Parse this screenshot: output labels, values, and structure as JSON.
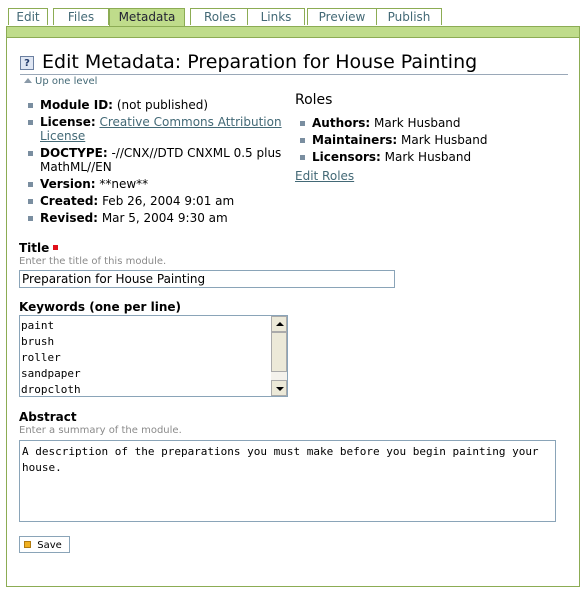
{
  "tabs": [
    {
      "label": "Edit",
      "selected": false
    },
    {
      "label": "Files",
      "selected": false
    },
    {
      "label": "Metadata",
      "selected": true
    },
    {
      "label": "Roles",
      "selected": false
    },
    {
      "label": "Links",
      "selected": false
    },
    {
      "label": "Preview",
      "selected": false
    },
    {
      "label": "Publish",
      "selected": false
    }
  ],
  "header": {
    "help_icon": "?",
    "title": "Edit Metadata: Preparation for House Painting",
    "up_link": "Up one level"
  },
  "meta": {
    "module_id_label": "Module ID:",
    "module_id_value": "(not published)",
    "license_label": "License:",
    "license_link": "Creative Commons Attribution License",
    "doctype_label": "DOCTYPE:",
    "doctype_value": "-//CNX//DTD CNXML 0.5 plus MathML//EN",
    "version_label": "Version:",
    "version_value": "**new**",
    "created_label": "Created:",
    "created_value": "Feb 26, 2004 9:01 am",
    "revised_label": "Revised:",
    "revised_value": "Mar 5, 2004 9:30 am"
  },
  "roles": {
    "heading": "Roles",
    "authors_label": "Authors:",
    "authors_value": "Mark Husband",
    "maintainers_label": "Maintainers:",
    "maintainers_value": "Mark Husband",
    "licensors_label": "Licensors:",
    "licensors_value": "Mark Husband",
    "edit_link": "Edit Roles"
  },
  "form": {
    "title_label": "Title",
    "title_hint": "Enter the title of this module.",
    "title_value": "Preparation for House Painting",
    "keywords_label": "Keywords (one per line)",
    "keywords": [
      "paint",
      "brush",
      "roller",
      "sandpaper",
      "dropcloth"
    ],
    "abstract_label": "Abstract",
    "abstract_hint": "Enter a summary of the module.",
    "abstract_value": "A description of the preparations you must make before you begin painting your house.",
    "save_label": "Save"
  },
  "colors": {
    "accent_green": "#bfdc8b",
    "border_green": "#8cac54",
    "link": "#436976",
    "required": "#e0101a"
  }
}
